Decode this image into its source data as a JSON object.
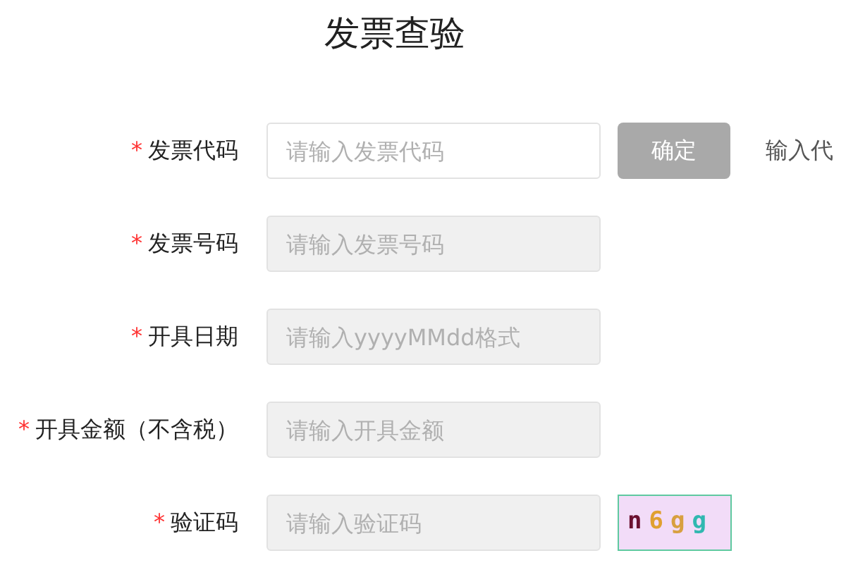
{
  "title": "发票查验",
  "fields": [
    {
      "required_mark": "*",
      "label": "发票代码",
      "placeholder": "请输入发票代码",
      "disabled": false,
      "kind": "text"
    },
    {
      "required_mark": "*",
      "label": "发票号码",
      "placeholder": "请输入发票号码",
      "disabled": true,
      "kind": "text"
    },
    {
      "required_mark": "*",
      "label": "开具日期",
      "placeholder": "请输入yyyyMMdd格式",
      "disabled": true,
      "kind": "text"
    },
    {
      "required_mark": "*",
      "label": "开具金额（不含税）",
      "placeholder": "请输入开具金额",
      "disabled": true,
      "kind": "text"
    },
    {
      "required_mark": "*",
      "label": "验证码",
      "placeholder": "请输入验证码",
      "disabled": true,
      "kind": "captcha"
    }
  ],
  "confirm_button": {
    "label": "确定",
    "disabled": true
  },
  "hint": "输入代",
  "captcha": [
    {
      "char": "n",
      "color": "#6b1030"
    },
    {
      "char": "6",
      "color": "#e0a030"
    },
    {
      "char": "g",
      "color": "#d8a040"
    },
    {
      "char": "g",
      "color": "#30b8b0"
    }
  ]
}
